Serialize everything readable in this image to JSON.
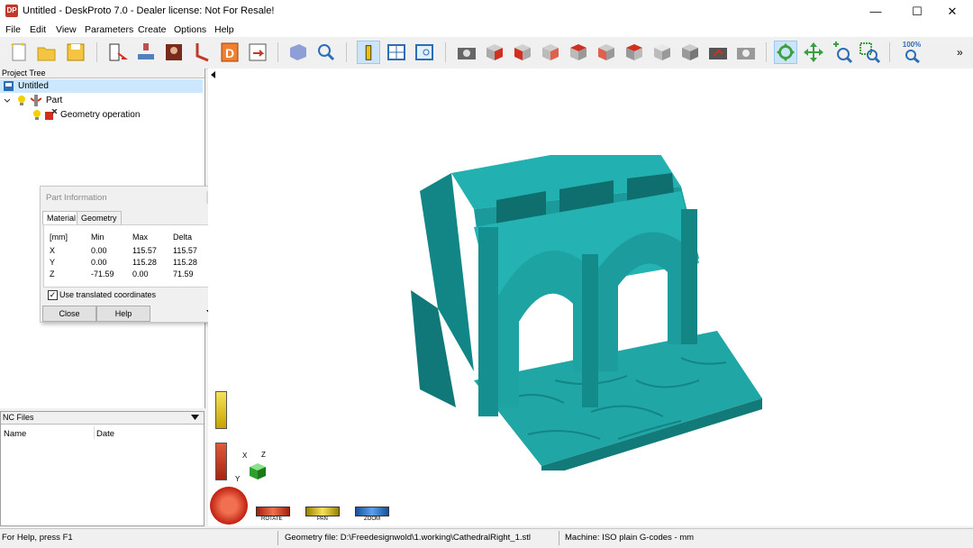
{
  "window": {
    "app_icon": "DP",
    "title": "Untitled - DeskProto 7.0 - Dealer license: Not For Resale!",
    "controls": {
      "minimize": "—",
      "maximize": "☐",
      "close": "✕"
    }
  },
  "menu": [
    "File",
    "Edit",
    "View",
    "Parameters",
    "Create",
    "Options",
    "Help"
  ],
  "toolbar": {
    "overflow": "»",
    "zoom_label": "100%",
    "icons": [
      "new-project-icon",
      "open-project-icon",
      "save-project-icon",
      "load-geometry-icon",
      "part-operation-icon",
      "image-icon",
      "vector-icon",
      "drawing-icon",
      "export-icon",
      "shaded-view-icon",
      "find-icon",
      "info-icon",
      "window-icon",
      "panel-icon",
      "camera-icon",
      "front-view-icon",
      "view-2-icon",
      "view-3-icon",
      "view-4-icon",
      "view-5-icon",
      "view-6-icon",
      "iso-view-icon",
      "view-8-icon",
      "render-icon",
      "snapshot-icon",
      "rotate-icon",
      "pan-icon",
      "zoom-in-icon",
      "zoom-window-icon",
      "zoom-all-icon"
    ]
  },
  "project_tree": {
    "header": "Project Tree",
    "items": [
      {
        "label": "Untitled",
        "icon": "project-icon"
      },
      {
        "label": "Part",
        "icon": "part-icon"
      },
      {
        "label": "Geometry operation",
        "icon": "geometry-operation-icon"
      }
    ]
  },
  "nc_files": {
    "header": "NC Files",
    "columns": [
      "Name",
      "Date"
    ]
  },
  "part_info": {
    "title": "Part Information",
    "tabs": [
      "Material",
      "Geometry"
    ],
    "headers": [
      "[mm]",
      "Min",
      "Max",
      "Delta"
    ],
    "rows": [
      [
        "X",
        "0.00",
        "115.57",
        "115.57"
      ],
      [
        "Y",
        "0.00",
        "115.28",
        "115.28"
      ],
      [
        "Z",
        "-71.59",
        "0.00",
        "71.59"
      ]
    ],
    "checkbox_label": "Use translated coordinates",
    "checkbox_checked": true,
    "close_button": "Close",
    "help_button": "Help"
  },
  "viewport": {
    "axes": {
      "x": "X",
      "y": "Y",
      "z": "Z"
    },
    "controls": {
      "rotate": "ROTATE",
      "pan": "PAN",
      "zoom": "ZOOM"
    },
    "model_color": "#1fa8a8"
  },
  "status": {
    "help": "For Help, press F1",
    "geometry_file": "Geometry file: D:\\Freedesignwold\\1.working\\CathedralRight_1.stl",
    "machine": "Machine: ISO plain G-codes - mm"
  }
}
